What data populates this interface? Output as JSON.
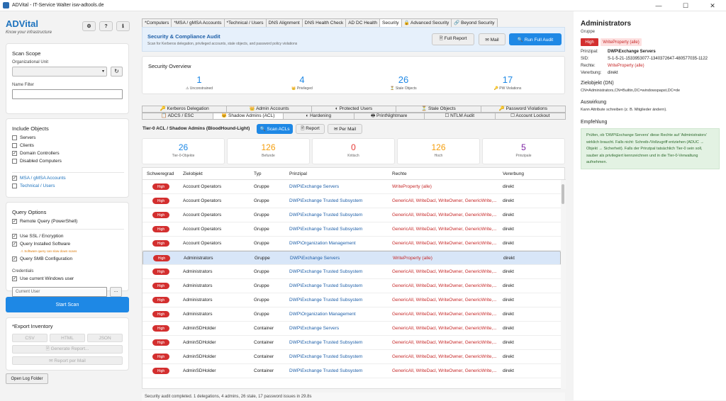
{
  "window": {
    "title": "ADVital - IT-Service Walter isw-adtools.de",
    "min": "—",
    "max": "☐",
    "close": "✕"
  },
  "brand": {
    "name": "ADVital",
    "tagline": "Know your infrastructure"
  },
  "header_buttons": {
    "settings": "⚙",
    "help": "?",
    "info": "ℹ"
  },
  "scan_scope": {
    "title": "Scan Scope",
    "ou_label": "Organizational Unit",
    "name_filter_label": "Name Filter",
    "refresh": "↻"
  },
  "include": {
    "title": "Include Objects",
    "items": [
      {
        "label": "Servers",
        "checked": false
      },
      {
        "label": "Clients",
        "checked": false
      },
      {
        "label": "Domain Controllers",
        "checked": true
      },
      {
        "label": "Disabled Computers",
        "checked": false
      }
    ],
    "extra": [
      {
        "label": "MSA / gMSA Accounts",
        "checked": true
      },
      {
        "label": "Technical / Users",
        "checked": false
      }
    ]
  },
  "options": {
    "title": "Query Options",
    "remote": "Remote Query (PowerShell)",
    "ssl": "Use SSL / Encryption",
    "software": "Query Installed Software",
    "warning": "⚠ Software query can slow down scans",
    "smb": "Query SMB Configuration",
    "credentials": "Credentials",
    "current_windows": "Use current Windows user",
    "current_user": "Current User",
    "more": "..."
  },
  "start_scan": "Start Scan",
  "export": {
    "title": "*Export Inventory",
    "csv": "CSV",
    "html": "HTML",
    "json": "JSON",
    "generate": "🖹 Generate Report...",
    "mail": "✉ Report per Mail"
  },
  "open_log": "Open Log Folder",
  "top_tabs": [
    "*Computers",
    "*MSA / gMSA Accounts",
    "*Technical / Users",
    "DNS Alignment",
    "DNS Health Check",
    "AD DC Health",
    "Security",
    "🔒 Advanced Security",
    "🔗 Beyond Security"
  ],
  "banner": {
    "title": "Security & Compliance Audit",
    "subtitle": "Scan for Kerberos delegation, privileged accounts, stale objects, and password policy violations",
    "full_report": "🖹 Full Report",
    "mail": "✉ Mail",
    "run": "🔍 Run Full Audit"
  },
  "overview": {
    "title": "Security Overview",
    "stats": [
      {
        "value": "1",
        "label": "⚠ Unconstrained"
      },
      {
        "value": "4",
        "label": "👑 Privileged"
      },
      {
        "value": "26",
        "label": "⏳ Stale Objects"
      },
      {
        "value": "17",
        "label": "🔑 PW Violations"
      }
    ]
  },
  "sub_tabs_row1": [
    "🔑 Kerberos Delegation",
    "👑 Admin Accounts",
    "◐ Protected Users",
    "⏳ Stale Objects",
    "🔑 Password Violations"
  ],
  "sub_tabs_row2": [
    "📋 ADCS / ESC",
    "🐱 Shadow Admins (ACL)",
    "◐ Hardening",
    "🖶 PrintNightmare",
    "☐ NTLM Audit",
    "☐ Account Lockout"
  ],
  "tier": {
    "title": "Tier-0 ACL / Shadow Admins (BloodHound-Light)",
    "scan": "🔍 Scan ACLs",
    "report": "🖹 Report",
    "mail": "✉ Per Mail"
  },
  "kpis": [
    {
      "value": "26",
      "label": "Tier-0-Objekte",
      "color": "#1e88e5"
    },
    {
      "value": "126",
      "label": "Befunde",
      "color": "#f59e0b"
    },
    {
      "value": "0",
      "label": "Kritisch",
      "color": "#e53935"
    },
    {
      "value": "126",
      "label": "Hoch",
      "color": "#f59e0b"
    },
    {
      "value": "5",
      "label": "Prinzipale",
      "color": "#7b1fa2"
    }
  ],
  "table": {
    "headers": [
      "Schweregrad",
      "Zielobjekt",
      "Typ",
      "Prinzipal",
      "Rechte",
      "Vererbung"
    ],
    "rows": [
      {
        "sev": "High",
        "target": "Account Operators",
        "type": "Gruppe",
        "principal": "DWP\\Exchange Servers",
        "rights": "WriteProperty (alle)",
        "inherit": "direkt"
      },
      {
        "sev": "High",
        "target": "Account Operators",
        "type": "Gruppe",
        "principal": "DWP\\Exchange Trusted Subsystem",
        "rights": "GenericAll, WriteDacl, WriteOwner, GenericWrite,...",
        "inherit": "direkt"
      },
      {
        "sev": "High",
        "target": "Account Operators",
        "type": "Gruppe",
        "principal": "DWP\\Exchange Trusted Subsystem",
        "rights": "GenericAll, WriteDacl, WriteOwner, GenericWrite,...",
        "inherit": "direkt"
      },
      {
        "sev": "High",
        "target": "Account Operators",
        "type": "Gruppe",
        "principal": "DWP\\Exchange Trusted Subsystem",
        "rights": "GenericAll, WriteDacl, WriteOwner, GenericWrite,...",
        "inherit": "direkt"
      },
      {
        "sev": "High",
        "target": "Account Operators",
        "type": "Gruppe",
        "principal": "DWP\\Organization Management",
        "rights": "GenericAll, WriteDacl, WriteOwner, GenericWrite,...",
        "inherit": "direkt"
      },
      {
        "sev": "High",
        "target": "Administrators",
        "type": "Gruppe",
        "principal": "DWP\\Exchange Servers",
        "rights": "WriteProperty (alle)",
        "inherit": "direkt"
      },
      {
        "sev": "High",
        "target": "Administrators",
        "type": "Gruppe",
        "principal": "DWP\\Exchange Trusted Subsystem",
        "rights": "GenericAll, WriteDacl, WriteOwner, GenericWrite,...",
        "inherit": "direkt"
      },
      {
        "sev": "High",
        "target": "Administrators",
        "type": "Gruppe",
        "principal": "DWP\\Exchange Trusted Subsystem",
        "rights": "GenericAll, WriteDacl, WriteOwner, GenericWrite,...",
        "inherit": "direkt"
      },
      {
        "sev": "High",
        "target": "Administrators",
        "type": "Gruppe",
        "principal": "DWP\\Exchange Trusted Subsystem",
        "rights": "GenericAll, WriteDacl, WriteOwner, GenericWrite,...",
        "inherit": "direkt"
      },
      {
        "sev": "High",
        "target": "Administrators",
        "type": "Gruppe",
        "principal": "DWP\\Organization Management",
        "rights": "GenericAll, WriteDacl, WriteOwner, GenericWrite,...",
        "inherit": "direkt"
      },
      {
        "sev": "High",
        "target": "AdminSDHolder",
        "type": "Container",
        "principal": "DWP\\Exchange Servers",
        "rights": "GenericAll, WriteDacl, WriteOwner, GenericWrite,...",
        "inherit": "direkt"
      },
      {
        "sev": "High",
        "target": "AdminSDHolder",
        "type": "Container",
        "principal": "DWP\\Exchange Trusted Subsystem",
        "rights": "GenericAll, WriteDacl, WriteOwner, GenericWrite,...",
        "inherit": "direkt"
      },
      {
        "sev": "High",
        "target": "AdminSDHolder",
        "type": "Container",
        "principal": "DWP\\Exchange Trusted Subsystem",
        "rights": "GenericAll, WriteDacl, WriteOwner, GenericWrite,...",
        "inherit": "direkt"
      },
      {
        "sev": "High",
        "target": "AdminSDHolder",
        "type": "Container",
        "principal": "DWP\\Exchange Trusted Subsystem",
        "rights": "GenericAll, WriteDacl, WriteOwner, GenericWrite,...",
        "inherit": "direkt"
      }
    ]
  },
  "status": "Security audit completed. 1 delegations, 4 admins, 26 stale, 17 password issues in 29.8s",
  "detail": {
    "title": "Administrators",
    "subtitle": "Gruppe",
    "sev": "High",
    "right_badge": "WriteProperty (alle)",
    "kv": [
      {
        "k": "Prinzipal:",
        "v": "DWP\\Exchange Servers"
      },
      {
        "k": "SID:",
        "v": "S-1-5-21-1533953077-1340372647-480577035-1122"
      },
      {
        "k": "Rechte:",
        "v": "WriteProperty (alle)"
      },
      {
        "k": "Vererbung:",
        "v": "direkt"
      }
    ],
    "target_head": "Zielobjekt (DN)",
    "target_dn": "CN=Administrators,CN=Builtin,DC=windowspapst,DC=de",
    "impact_head": "Auswirkung",
    "impact": "Kann Attribute schreiben (z. B. Mitglieder ändern).",
    "rec_head": "Empfehlung",
    "rec": "Prüfen, ob 'DWP\\Exchange Servers' diese Rechte auf 'Administrators' wirklich braucht. Falls nicht: Schreib-/Vollzugriff entziehen (ADUC → Objekt → Sicherheit). Falls der Prinzipal tatsächlich Tier-0 sein soll, sauber als privilegiert kennzeichnen und in die Tier-0-Verwaltung aufnehmen."
  }
}
